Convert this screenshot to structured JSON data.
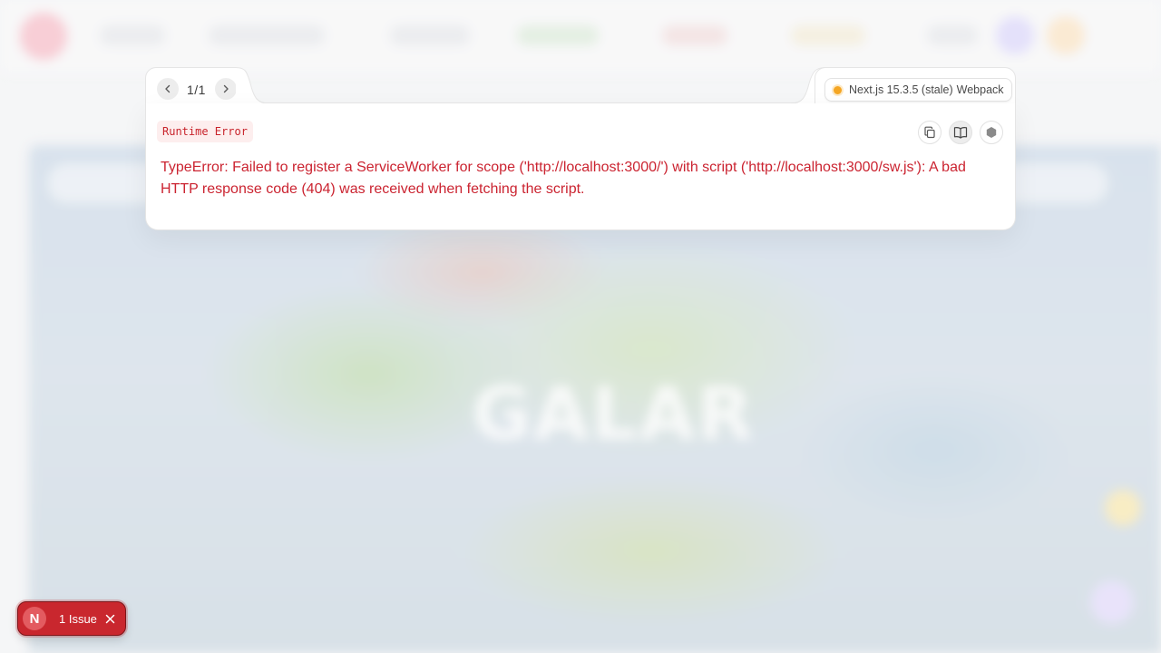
{
  "overlay": {
    "pager": {
      "text": "1/1",
      "prev_icon": "chevron-left-icon",
      "next_icon": "chevron-right-icon"
    },
    "version": {
      "label": "Next.js 15.3.5 (stale)",
      "bundler": "Webpack",
      "status_color": "#f5a623"
    },
    "error": {
      "badge": "Runtime Error",
      "message": "TypeError: Failed to register a ServiceWorker for scope ('http://localhost:3000/') with script ('http://localhost:3000/sw.js'): A bad HTTP response code (404) was received when fetching the script."
    },
    "tools": [
      {
        "name": "copy-icon"
      },
      {
        "name": "docs-book-icon"
      },
      {
        "name": "node-hexagon-icon"
      }
    ]
  },
  "issues_toast": {
    "label": "1 Issue",
    "logo_letter": "N",
    "close_icon": "close-icon"
  },
  "background": {
    "map_title": "GALAR"
  },
  "colors": {
    "error_red": "#cb2431",
    "toast_red": "#c9272e",
    "badge_bg": "#fdeeee"
  }
}
